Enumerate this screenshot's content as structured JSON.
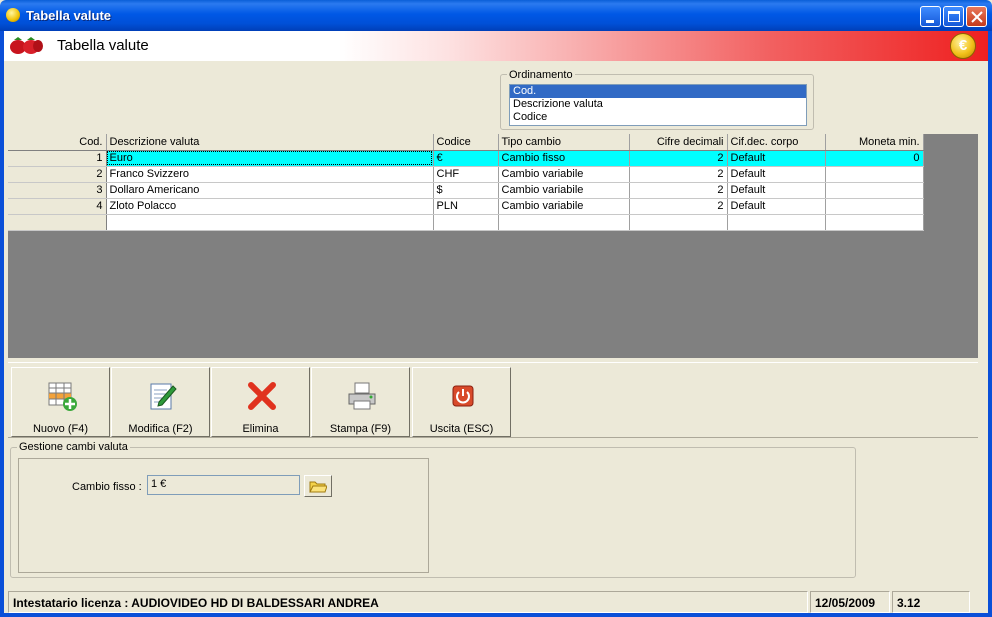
{
  "window": {
    "title": "Tabella valute"
  },
  "banner": {
    "title": "Tabella valute",
    "coin_symbol": "€"
  },
  "ordinamento": {
    "legend": "Ordinamento",
    "options": [
      "Cod.",
      "Descrizione valuta",
      "Codice"
    ],
    "selected": "Cod."
  },
  "grid": {
    "columns": [
      "Cod.",
      "Descrizione valuta",
      "Codice",
      "Tipo cambio",
      "Cifre decimali",
      "Cif.dec. corpo",
      "Moneta min."
    ],
    "rows": [
      {
        "cod": "1",
        "descr": "Euro",
        "codice": "€",
        "tipo": "Cambio fisso",
        "cifre": "2",
        "corpo": "Default",
        "moneta": "0"
      },
      {
        "cod": "2",
        "descr": "Franco Svizzero",
        "codice": "CHF",
        "tipo": "Cambio variabile",
        "cifre": "2",
        "corpo": "Default",
        "moneta": ""
      },
      {
        "cod": "3",
        "descr": "Dollaro Americano",
        "codice": "$",
        "tipo": "Cambio variabile",
        "cifre": "2",
        "corpo": "Default",
        "moneta": ""
      },
      {
        "cod": "4",
        "descr": "Zloto Polacco",
        "codice": "PLN",
        "tipo": "Cambio variabile",
        "cifre": "2",
        "corpo": "Default",
        "moneta": ""
      }
    ],
    "selected_row_color": "#00ffff"
  },
  "toolbar": {
    "nuovo": "Nuovo (F4)",
    "modifica": "Modifica (F2)",
    "elimina": "Elimina",
    "stampa": "Stampa (F9)",
    "uscita": "Uscita (ESC)"
  },
  "gestione": {
    "legend": "Gestione cambi valuta",
    "label": "Cambio fisso :",
    "value": "1 €"
  },
  "status": {
    "license": "Intestatario licenza : AUDIOVIDEO HD DI BALDESSARI ANDREA",
    "date": "12/05/2009",
    "version": "3.12"
  },
  "icons": {
    "app": "app-icon",
    "banner_left": "strawberries-icon",
    "banner_right": "euro-coin-icon",
    "nuovo": "add-grid-icon",
    "modifica": "edit-document-icon",
    "elimina": "red-x-icon",
    "stampa": "printer-icon",
    "uscita": "power-icon",
    "browse": "folder-icon"
  }
}
